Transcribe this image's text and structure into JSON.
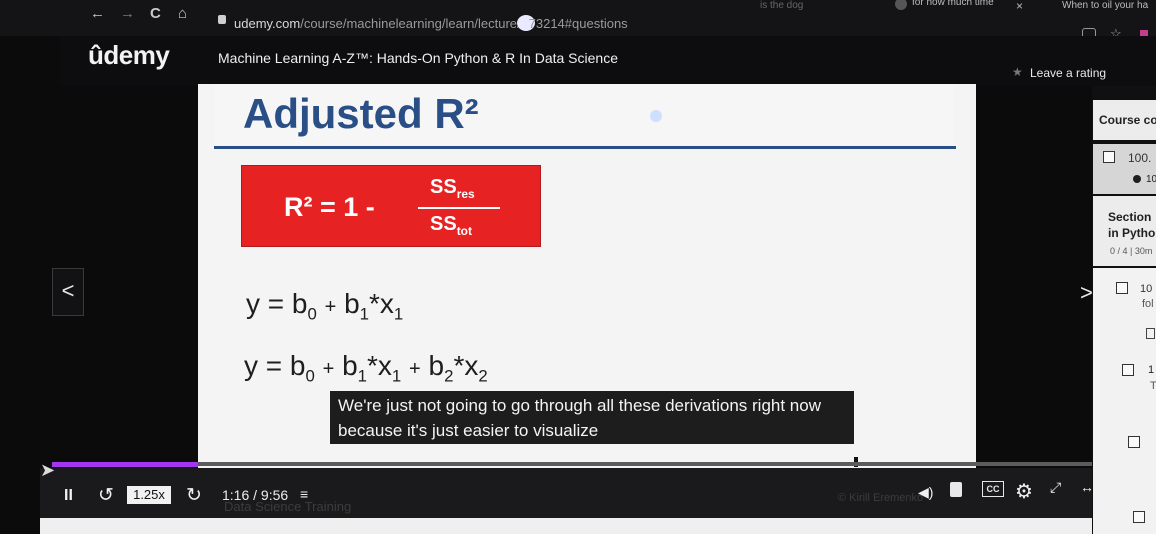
{
  "browser": {
    "url_domain": "udemy.com",
    "url_path": "/course/machinelearning/learn/lecture/",
    "url_tail": "73214#questions",
    "tab_1": "for how much time",
    "tab_1_close": "×",
    "tab_2": "When to oil your ha",
    "tab_3_fragment": "is the dog",
    "nav": {
      "back": "←",
      "forward": "→",
      "reload": "C",
      "home": "⌂"
    }
  },
  "udemy": {
    "logo": "ûdemy",
    "course_title": "Machine Learning A-Z™: Hands-On Python & R In Data Science",
    "leave_rating": "Leave a rating",
    "star": "★"
  },
  "slide": {
    "heading": "Adjusted R²",
    "formula": {
      "lhs": "R² = 1 -",
      "num_base": "SS",
      "num_sub": "res",
      "den_base": "SS",
      "den_sub": "tot"
    },
    "eq1": {
      "y": "y",
      "eq": "=",
      "b": "b",
      "b0": "0",
      "plus1": "+",
      "b1": "b",
      "s1": "1",
      "x1": "*x",
      "xs1": "1"
    },
    "eq2": {
      "y": "y",
      "eq": "=",
      "b": "b",
      "b0": "0",
      "plus1": "+",
      "b1": "b",
      "s1": "1",
      "x1": "*x",
      "xs1": "1",
      "plus2": "+",
      "b2": "b",
      "s2": "2",
      "x2": "*x",
      "xs2": "2"
    }
  },
  "caption": {
    "line1": "We're just not going to go through all these derivations right now",
    "line2": "because it's just easier to visualize"
  },
  "player": {
    "prev": "<",
    "next": ">",
    "pause": "II",
    "rewind": "↺",
    "speed": "1.25x",
    "forward": "↻",
    "time": "1:16 / 9:56",
    "watermark": "Data Science Training",
    "watermark2": "© Kirill Eremenko",
    "cc": "CC",
    "progress": 0.1388
  },
  "sidebar": {
    "course_content": "Course co",
    "item_100": "100. ",
    "item_100_sub": "10",
    "section_line1": "Section",
    "section_line2": "in Pytho",
    "section_meta": "0 / 4 | 30m",
    "item_10a": "10",
    "item_10a_sub": "fol",
    "item_1": "1",
    "item_1_sub": "T"
  }
}
